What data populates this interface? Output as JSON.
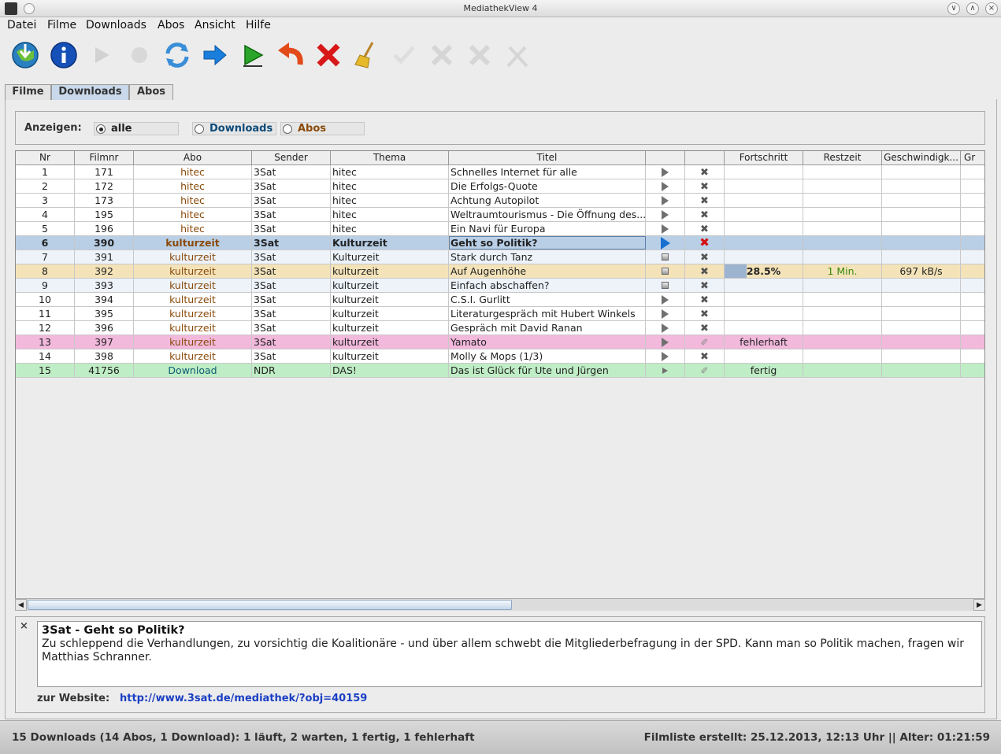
{
  "window": {
    "title": "MediathekView 4"
  },
  "menu": [
    "Datei",
    "Filme",
    "Downloads",
    "Abos",
    "Ansicht",
    "Hilfe"
  ],
  "toolbar": {
    "icons": [
      "download-globe-icon",
      "info-icon",
      "play-disabled-icon",
      "record-disabled-icon",
      "refresh-icon",
      "forward-arrow-icon",
      "play-green-icon",
      "undo-arrow-icon",
      "delete-x-icon",
      "broom-icon",
      "check-disabled-icon",
      "x-disabled-icon",
      "x-disabled-icon",
      "tools-disabled-icon"
    ]
  },
  "tabs": [
    "Filme",
    "Downloads",
    "Abos"
  ],
  "filter": {
    "label": "Anzeigen:",
    "options": [
      "alle",
      "Downloads",
      "Abos"
    ],
    "selected": "alle",
    "option_colors": [
      "#222222",
      "#0b4a7a",
      "#8a4a0a"
    ]
  },
  "table": {
    "columns": [
      "Nr",
      "Filmnr",
      "Abo",
      "Sender",
      "Thema",
      "Titel",
      "",
      "",
      "Fortschritt",
      "Restzeit",
      "Geschwindigk...",
      "Gr"
    ],
    "rows": [
      {
        "nr": "1",
        "filmnr": "171",
        "abo": "hitec",
        "sender": "3Sat",
        "thema": "hitec",
        "titel": "Schnelles Internet für alle",
        "action": "play",
        "remove": "x",
        "fortschritt": "",
        "restzeit": "",
        "geschw": "",
        "state": "normal"
      },
      {
        "nr": "2",
        "filmnr": "172",
        "abo": "hitec",
        "sender": "3Sat",
        "thema": "hitec",
        "titel": "Die Erfolgs-Quote",
        "action": "play",
        "remove": "x",
        "fortschritt": "",
        "restzeit": "",
        "geschw": "",
        "state": "normal"
      },
      {
        "nr": "3",
        "filmnr": "173",
        "abo": "hitec",
        "sender": "3Sat",
        "thema": "hitec",
        "titel": "Achtung Autopilot",
        "action": "play",
        "remove": "x",
        "fortschritt": "",
        "restzeit": "",
        "geschw": "",
        "state": "normal"
      },
      {
        "nr": "4",
        "filmnr": "195",
        "abo": "hitec",
        "sender": "3Sat",
        "thema": "hitec",
        "titel": "Weltraumtourismus - Die Öffnung des...",
        "action": "play",
        "remove": "x",
        "fortschritt": "",
        "restzeit": "",
        "geschw": "",
        "state": "normal"
      },
      {
        "nr": "5",
        "filmnr": "196",
        "abo": "hitec",
        "sender": "3Sat",
        "thema": "hitec",
        "titel": "Ein Navi für Europa",
        "action": "play",
        "remove": "x",
        "fortschritt": "",
        "restzeit": "",
        "geschw": "",
        "state": "normal"
      },
      {
        "nr": "6",
        "filmnr": "390",
        "abo": "kulturzeit",
        "sender": "3Sat",
        "thema": "Kulturzeit",
        "titel": "Geht  so Politik?",
        "action": "play-blue",
        "remove": "x-red",
        "fortschritt": "",
        "restzeit": "",
        "geschw": "",
        "state": "selected"
      },
      {
        "nr": "7",
        "filmnr": "391",
        "abo": "kulturzeit",
        "sender": "3Sat",
        "thema": "Kulturzeit",
        "titel": "Stark durch Tanz",
        "action": "stop",
        "remove": "x",
        "fortschritt": "",
        "restzeit": "",
        "geschw": "",
        "state": "waiting"
      },
      {
        "nr": "8",
        "filmnr": "392",
        "abo": "kulturzeit",
        "sender": "3Sat",
        "thema": "kulturzeit",
        "titel": "Auf Augenhöhe",
        "action": "stop",
        "remove": "x",
        "fortschritt": "28.5%",
        "progress": 0.285,
        "restzeit": "1 Min.",
        "geschw": "697 kB/s",
        "state": "running"
      },
      {
        "nr": "9",
        "filmnr": "393",
        "abo": "kulturzeit",
        "sender": "3Sat",
        "thema": "kulturzeit",
        "titel": "Einfach abschaffen?",
        "action": "stop",
        "remove": "x",
        "fortschritt": "",
        "restzeit": "",
        "geschw": "",
        "state": "waiting"
      },
      {
        "nr": "10",
        "filmnr": "394",
        "abo": "kulturzeit",
        "sender": "3Sat",
        "thema": "kulturzeit",
        "titel": "C.S.I. Gurlitt",
        "action": "play",
        "remove": "x",
        "fortschritt": "",
        "restzeit": "",
        "geschw": "",
        "state": "normal"
      },
      {
        "nr": "11",
        "filmnr": "395",
        "abo": "kulturzeit",
        "sender": "3Sat",
        "thema": "kulturzeit",
        "titel": "Literaturgespräch mit Hubert Winkels",
        "action": "play",
        "remove": "x",
        "fortschritt": "",
        "restzeit": "",
        "geschw": "",
        "state": "normal"
      },
      {
        "nr": "12",
        "filmnr": "396",
        "abo": "kulturzeit",
        "sender": "3Sat",
        "thema": "kulturzeit",
        "titel": "Gespräch mit David Ranan",
        "action": "play",
        "remove": "x",
        "fortschritt": "",
        "restzeit": "",
        "geschw": "",
        "state": "normal"
      },
      {
        "nr": "13",
        "filmnr": "397",
        "abo": "kulturzeit",
        "sender": "3Sat",
        "thema": "kulturzeit",
        "titel": "Yamato",
        "action": "play",
        "remove": "broom",
        "fortschritt": "fehlerhaft",
        "restzeit": "",
        "geschw": "",
        "state": "error"
      },
      {
        "nr": "14",
        "filmnr": "398",
        "abo": "kulturzeit",
        "sender": "3Sat",
        "thema": "kulturzeit",
        "titel": "Molly & Mops (1/3)",
        "action": "play",
        "remove": "x",
        "fortschritt": "",
        "restzeit": "",
        "geschw": "",
        "state": "normal"
      },
      {
        "nr": "15",
        "filmnr": "41756",
        "abo": "Download",
        "sender": "NDR",
        "thema": "DAS!",
        "titel": "Das ist  Glück für Ute und Jürgen",
        "action": "play-small",
        "remove": "broom",
        "fortschritt": "fertig",
        "restzeit": "",
        "geschw": "",
        "state": "done"
      }
    ]
  },
  "info": {
    "title": "3Sat - Geht so Politik?",
    "description": "Zu schleppend die Verhandlungen, zu vorsichtig die Koalitionäre - und über allem schwebt die Mitgliederbefragung in der SPD. Kann man so Politik machen, fragen wir Matthias Schranner.",
    "website_label": "zur Website:",
    "website_url": "http://www.3sat.de/mediathek/?obj=40159"
  },
  "status": {
    "left": "15 Downloads (14 Abos, 1 Download): 1 läuft, 2 warten, 1 fertig, 1 fehlerhaft",
    "right": "Filmliste erstellt: 25.12.2013, 12:13 Uhr  ||  Alter: 01:21:59"
  },
  "colors": {
    "selected_row": "#b9cfe6",
    "waiting_row": "#eef3fa",
    "running_row": "#f4e3b9",
    "error_row": "#f2b9dc",
    "done_row": "#bfedc5",
    "progress_fill": "#9db4d0",
    "abo_text": "#8a4a0a",
    "download_text": "#0b5d70",
    "restzeit_text": "#3a8a0a"
  }
}
